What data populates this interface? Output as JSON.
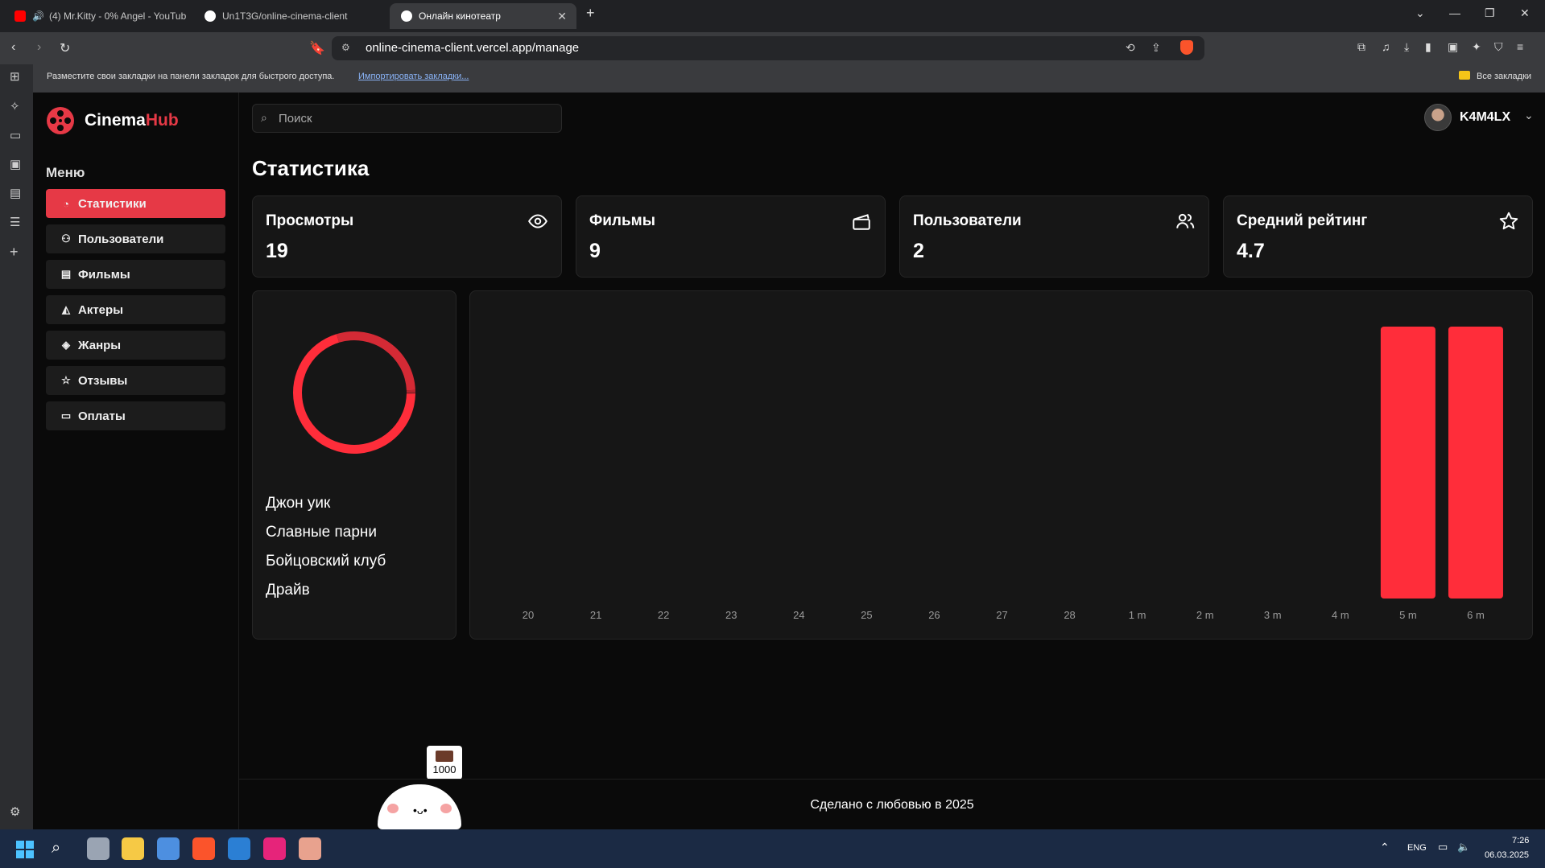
{
  "browser": {
    "tabs": [
      {
        "label": "(4) Mr.Kitty - 0% Angel - YouTub"
      },
      {
        "label": "Un1T3G/online-cinema-client"
      },
      {
        "label": "Онлайн кинотеатр"
      }
    ],
    "url": "online-cinema-client.vercel.app/manage",
    "bookmarks_text": "Разместите свои закладки на панели закладок для быстрого доступа.",
    "bookmarks_import": "Импортировать закладки...",
    "bookmarks_all": "Все закладки"
  },
  "app": {
    "logo_part1": "Cinema",
    "logo_part2": "Hub",
    "search_placeholder": "Поиск",
    "user_name": "K4M4LX",
    "menu_title": "Меню",
    "menu": [
      {
        "label": "Статистики",
        "icon": "chart-pie-icon",
        "active": true
      },
      {
        "label": "Пользователи",
        "icon": "user-icon"
      },
      {
        "label": "Фильмы",
        "icon": "clapperboard-icon"
      },
      {
        "label": "Актеры",
        "icon": "mask-icon"
      },
      {
        "label": "Жанры",
        "icon": "layers-icon"
      },
      {
        "label": "Отзывы",
        "icon": "star-icon"
      },
      {
        "label": "Оплаты",
        "icon": "banknote-icon"
      }
    ]
  },
  "page": {
    "title": "Статистика",
    "stats": [
      {
        "label": "Просмотры",
        "value": "19",
        "icon": "eye-icon"
      },
      {
        "label": "Фильмы",
        "value": "9",
        "icon": "clapperboard-icon"
      },
      {
        "label": "Пользователи",
        "value": "2",
        "icon": "users-icon"
      },
      {
        "label": "Средний рейтинг",
        "value": "4.7",
        "icon": "star-icon"
      }
    ],
    "top_movies": [
      "Джон уик",
      "Славные парни",
      "Бойцовский клуб",
      "Драйв"
    ],
    "footer": "Сделано с любовью в 2025"
  },
  "chart_data": [
    {
      "type": "pie",
      "labels": [
        "Джон уик",
        "Славные парни",
        "Бойцовский клуб",
        "Драйв"
      ],
      "values": [
        70,
        29,
        0.5,
        0.5
      ],
      "colors": [
        "#ff2d3a",
        "#d42a35",
        "#b8252e",
        "#a0222a"
      ]
    },
    {
      "type": "bar",
      "categories": [
        "20",
        "21",
        "22",
        "23",
        "24",
        "25",
        "26",
        "27",
        "28",
        "1 m",
        "2 m",
        "3 m",
        "4 m",
        "5 m",
        "6 m"
      ],
      "values": [
        0,
        0,
        0,
        0,
        0,
        0,
        0,
        0,
        0,
        0,
        0,
        0,
        0,
        1,
        1
      ],
      "ylim": [
        0,
        1
      ],
      "color": "#ff2d3a"
    }
  ],
  "widget": {
    "label": "1000"
  },
  "taskbar": {
    "lang": "ENG",
    "time": "7:26",
    "date": "06.03.2025"
  }
}
